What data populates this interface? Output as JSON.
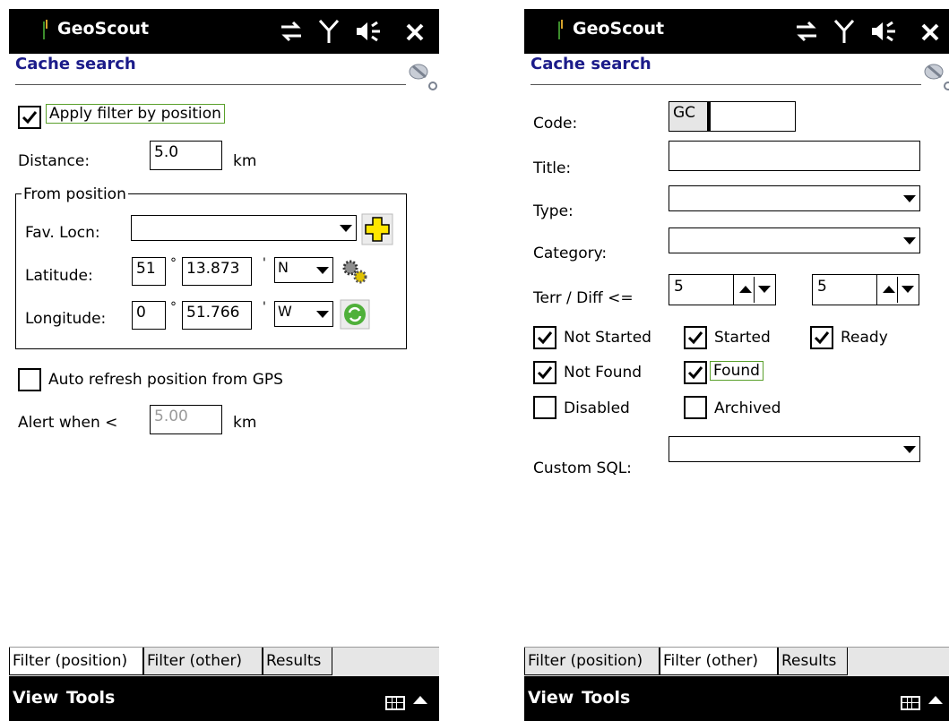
{
  "colors": {
    "heading": "#1c1c8a",
    "highlight_border": "#5aa02c",
    "titlebar_bg": "#000000",
    "tab_bar_bg": "#e6e6e6"
  },
  "status_icons": [
    "sync-icon",
    "antenna-icon",
    "speaker-icon",
    "close-icon"
  ],
  "left": {
    "app_name": "GeoScout",
    "heading": "Cache search",
    "apply_filter": {
      "label": "Apply filter by position",
      "checked": true
    },
    "distance": {
      "label": "Distance:",
      "value": "5.0",
      "unit": "km"
    },
    "from_position": {
      "title": "From position",
      "fav_locn": {
        "label": "Fav. Locn:",
        "value": ""
      },
      "latitude": {
        "label": "Latitude:",
        "deg": "51",
        "deg_sym": "°",
        "min": "13.873",
        "min_sym": "'",
        "hemi": "N"
      },
      "longitude": {
        "label": "Longitude:",
        "deg": "0",
        "deg_sym": "°",
        "min": "51.766",
        "min_sym": "'",
        "hemi": "W"
      }
    },
    "auto_refresh": {
      "label": "Auto refresh position from GPS",
      "checked": false
    },
    "alert": {
      "label": "Alert when <",
      "value": "5.00",
      "unit": "km"
    },
    "tabs": [
      "Filter (position)",
      "Filter (other)",
      "Results"
    ],
    "active_tab": 0,
    "menu": {
      "view": "View",
      "tools": "Tools"
    }
  },
  "right": {
    "app_name": "GeoScout",
    "heading": "Cache search",
    "code": {
      "label": "Code:",
      "prefix": "GC",
      "value": ""
    },
    "title": {
      "label": "Title:",
      "value": ""
    },
    "type": {
      "label": "Type:",
      "value": ""
    },
    "category": {
      "label": "Category:",
      "value": ""
    },
    "terr_diff": {
      "label": "Terr / Diff <=",
      "terr": "5",
      "diff": "5"
    },
    "checks": [
      {
        "label": "Not Started",
        "checked": true
      },
      {
        "label": "Started",
        "checked": true
      },
      {
        "label": "Ready",
        "checked": true
      },
      {
        "label": "Not Found",
        "checked": true
      },
      {
        "label": "Found",
        "checked": true
      },
      {
        "label": "Disabled",
        "checked": false
      },
      {
        "label": "Archived",
        "checked": false
      }
    ],
    "custom_sql": {
      "label": "Custom SQL:",
      "value": ""
    },
    "tabs": [
      "Filter (position)",
      "Filter (other)",
      "Results"
    ],
    "active_tab": 1,
    "menu": {
      "view": "View",
      "tools": "Tools"
    }
  }
}
